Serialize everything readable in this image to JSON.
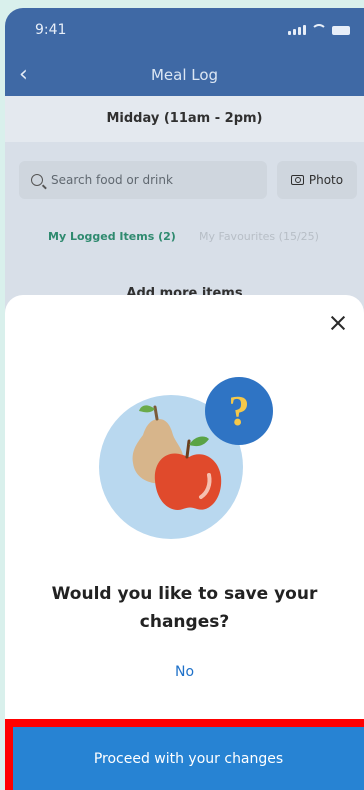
{
  "status_bar": {
    "time": "9:41"
  },
  "header": {
    "title": "Meal Log",
    "back_icon": "chevron-left-icon"
  },
  "meal_section": {
    "title": "Midday (11am - 2pm)"
  },
  "search": {
    "placeholder": "Search food or drink",
    "icon": "search-icon"
  },
  "photo_button": {
    "label": "Photo",
    "icon": "camera-icon"
  },
  "tabs": [
    {
      "label": "My Logged Items (2)",
      "active": true
    },
    {
      "label": "My Favourites (15/25)",
      "active": false
    }
  ],
  "add_more": {
    "label": "Add more items"
  },
  "modal": {
    "title": "Would you like to save your changes?",
    "no_label": "No",
    "proceed_label": "Proceed with your changes",
    "close_icon": "close-icon",
    "illustration_icon": "fruit-question-icon"
  },
  "colors": {
    "header": "#3f69a5",
    "accent_green": "#2f8a6f",
    "link_blue": "#1f71c9",
    "cta_blue": "#2783d3",
    "highlight_red": "#ff0000"
  }
}
